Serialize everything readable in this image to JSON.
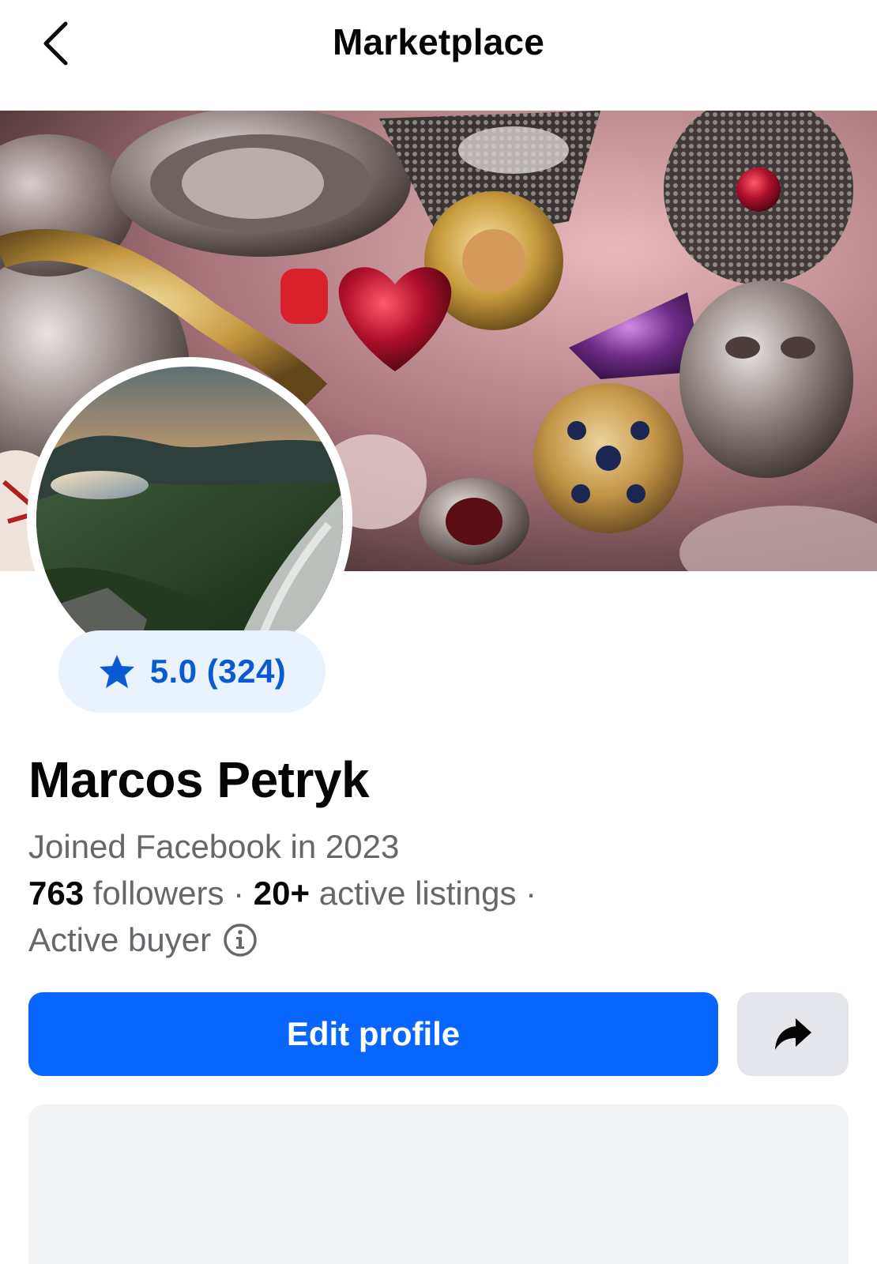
{
  "header": {
    "title": "Marketplace",
    "back_icon": "chevron-left-icon"
  },
  "cover": {
    "description_icon": "cover-photo"
  },
  "profile": {
    "rating_icon": "star-icon",
    "rating_text": "5.0 (324)",
    "name": "Marcos Petryk",
    "joined": "Joined Facebook in 2023",
    "followers_count": "763",
    "followers_label": " followers · ",
    "listings_count": "20+",
    "listings_label": " active listings ·",
    "status": "Active buyer",
    "status_info_icon": "info-icon"
  },
  "actions": {
    "edit_profile": "Edit profile",
    "share_icon": "share-arrow-icon"
  },
  "colors": {
    "accent": "#0866ff",
    "rating_text": "#0a5bd3",
    "rating_bg": "#eaf2fd",
    "secondary_text": "#65676b"
  }
}
